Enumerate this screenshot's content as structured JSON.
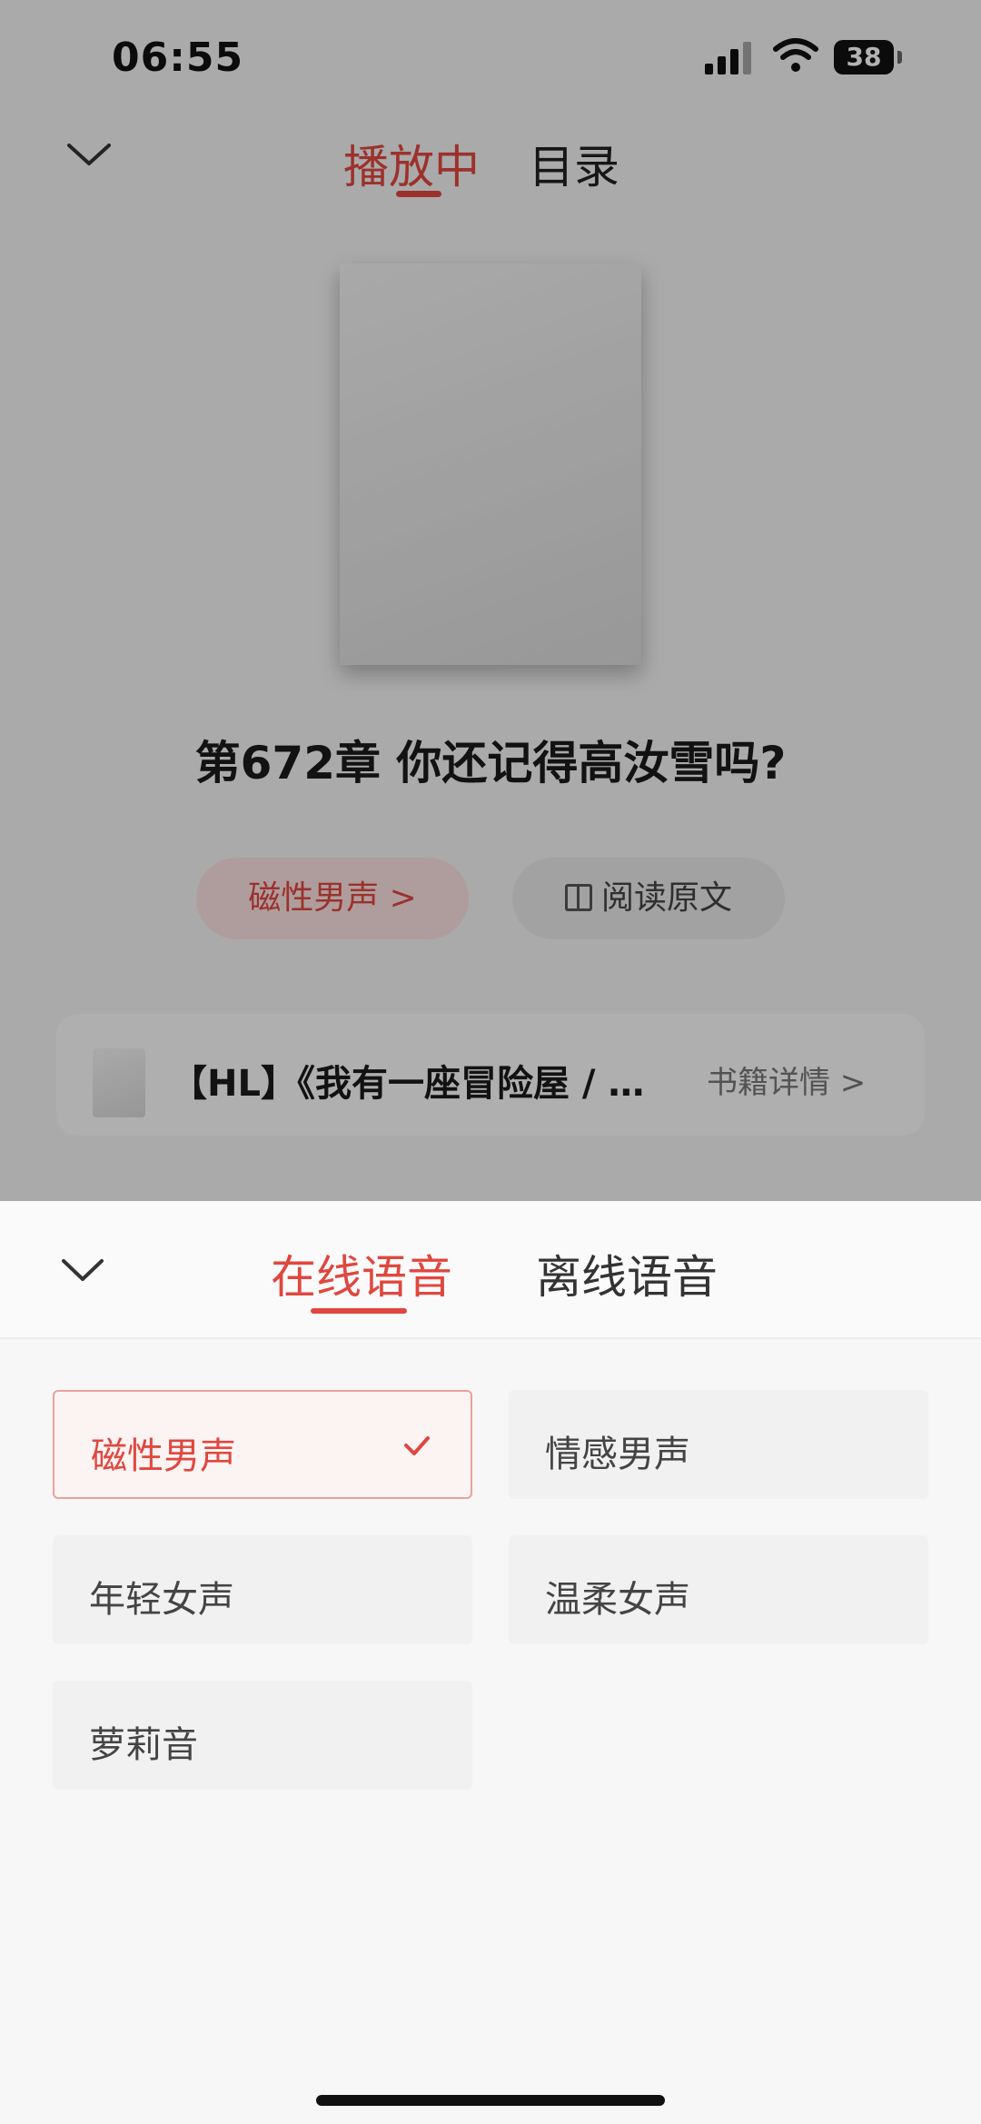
{
  "status_bar": {
    "time": "06:55",
    "battery": "38"
  },
  "player": {
    "tabs": [
      "播放中",
      "目录"
    ],
    "active_tab": "播放中",
    "chapter_title": "第672章 你还记得高汝雪吗?",
    "voice_button_label": "磁性男声 >",
    "read_button_label": "阅读原文",
    "book_card": {
      "title": "【HL】《我有一座冒险屋 / …",
      "detail_label": "书籍详情 >"
    }
  },
  "sheet": {
    "tabs": [
      "在线语音",
      "离线语音"
    ],
    "active_tab": "在线语音",
    "voices": [
      "磁性男声",
      "情感男声",
      "年轻女声",
      "温柔女声",
      "萝莉音"
    ],
    "selected_voice": "磁性男声"
  },
  "colors": {
    "accent": "#e0473f",
    "selected_border": "#e8a39b"
  }
}
